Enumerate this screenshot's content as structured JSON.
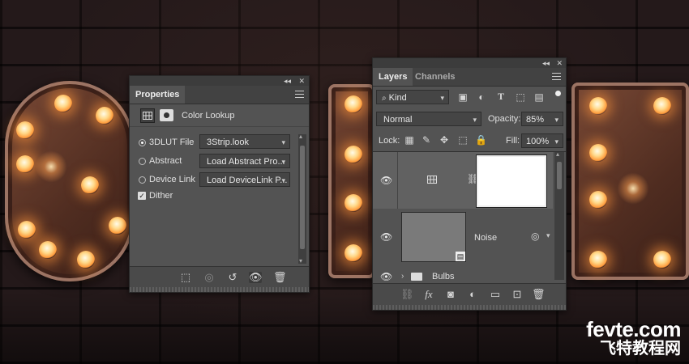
{
  "properties": {
    "tab_label": "Properties",
    "adjustment_title": "Color Lookup",
    "options": [
      {
        "label": "3DLUT File",
        "value": "3Strip.look",
        "selected": true
      },
      {
        "label": "Abstract",
        "value": "Load Abstract Pro...",
        "selected": false
      },
      {
        "label": "Device Link",
        "value": "Load DeviceLink P...",
        "selected": false
      }
    ],
    "dither_label": "Dither",
    "dither_checked": true
  },
  "layers": {
    "tabs": [
      "Layers",
      "Channels"
    ],
    "filter_kind": "Kind",
    "blend_mode": "Normal",
    "opacity_label": "Opacity:",
    "opacity_value": "85%",
    "lock_label": "Lock:",
    "fill_label": "Fill:",
    "fill_value": "100%",
    "items": [
      {
        "name": "",
        "type": "adjustment",
        "visible": true,
        "selected": true
      },
      {
        "name": "Noise",
        "type": "smart-object",
        "visible": true,
        "selected": false
      },
      {
        "name": "Bulbs",
        "type": "group",
        "visible": true,
        "selected": false
      }
    ]
  },
  "watermark": {
    "line1": "fevte.com",
    "line2": "飞特教程网"
  },
  "icons": {
    "collapse": "double-chevron-icon",
    "close": "close-icon",
    "eye": "eye-icon",
    "link": "chain-link-icon",
    "folder": "folder-icon",
    "trash": "trash-icon"
  }
}
